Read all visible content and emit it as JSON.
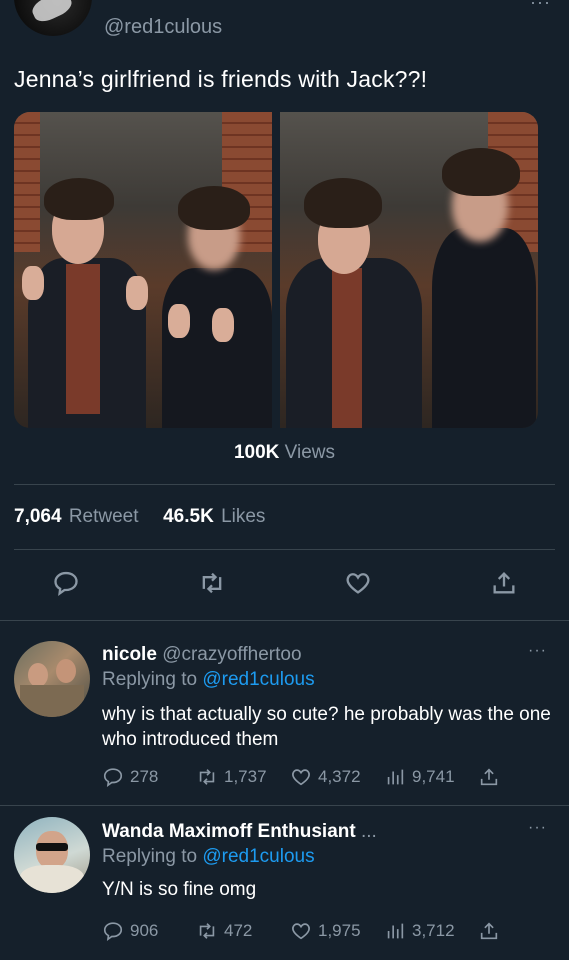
{
  "tweet": {
    "handle": "@red1culous",
    "text": "Jenna’s girlfriend is friends with Jack??!",
    "views_count": "100K",
    "views_label": "Views",
    "retweets_count": "7,064",
    "retweets_label": "Retweet",
    "likes_count": "46.5K",
    "likes_label": "Likes",
    "more": "···"
  },
  "actions": [
    "reply-icon",
    "retweet-icon",
    "like-icon",
    "share-icon"
  ],
  "replies": [
    {
      "name": "nicole",
      "handle": "@crazyoffhertoo",
      "replying_prefix": "Replying to",
      "replying_to": "@red1culous",
      "text": "why is that actually so cute? he probably was the one who introduced them",
      "reply_count": "278",
      "retweet_count": "1,737",
      "like_count": "4,372",
      "view_count": "9,741",
      "more": "···"
    },
    {
      "name": "Wanda Maximoff Enthusiant",
      "name_suffix": "...",
      "replying_prefix": "Replying to",
      "replying_to": "@red1culous",
      "text": "Y/N is so fine omg",
      "reply_count": "906",
      "retweet_count": "472",
      "like_count": "1,975",
      "view_count": "3,712",
      "more": "···"
    }
  ],
  "colors": {
    "background": "#15202b",
    "text": "#ffffff",
    "muted": "#8b98a5",
    "link": "#1d9bf0",
    "divider": "#38444d"
  }
}
